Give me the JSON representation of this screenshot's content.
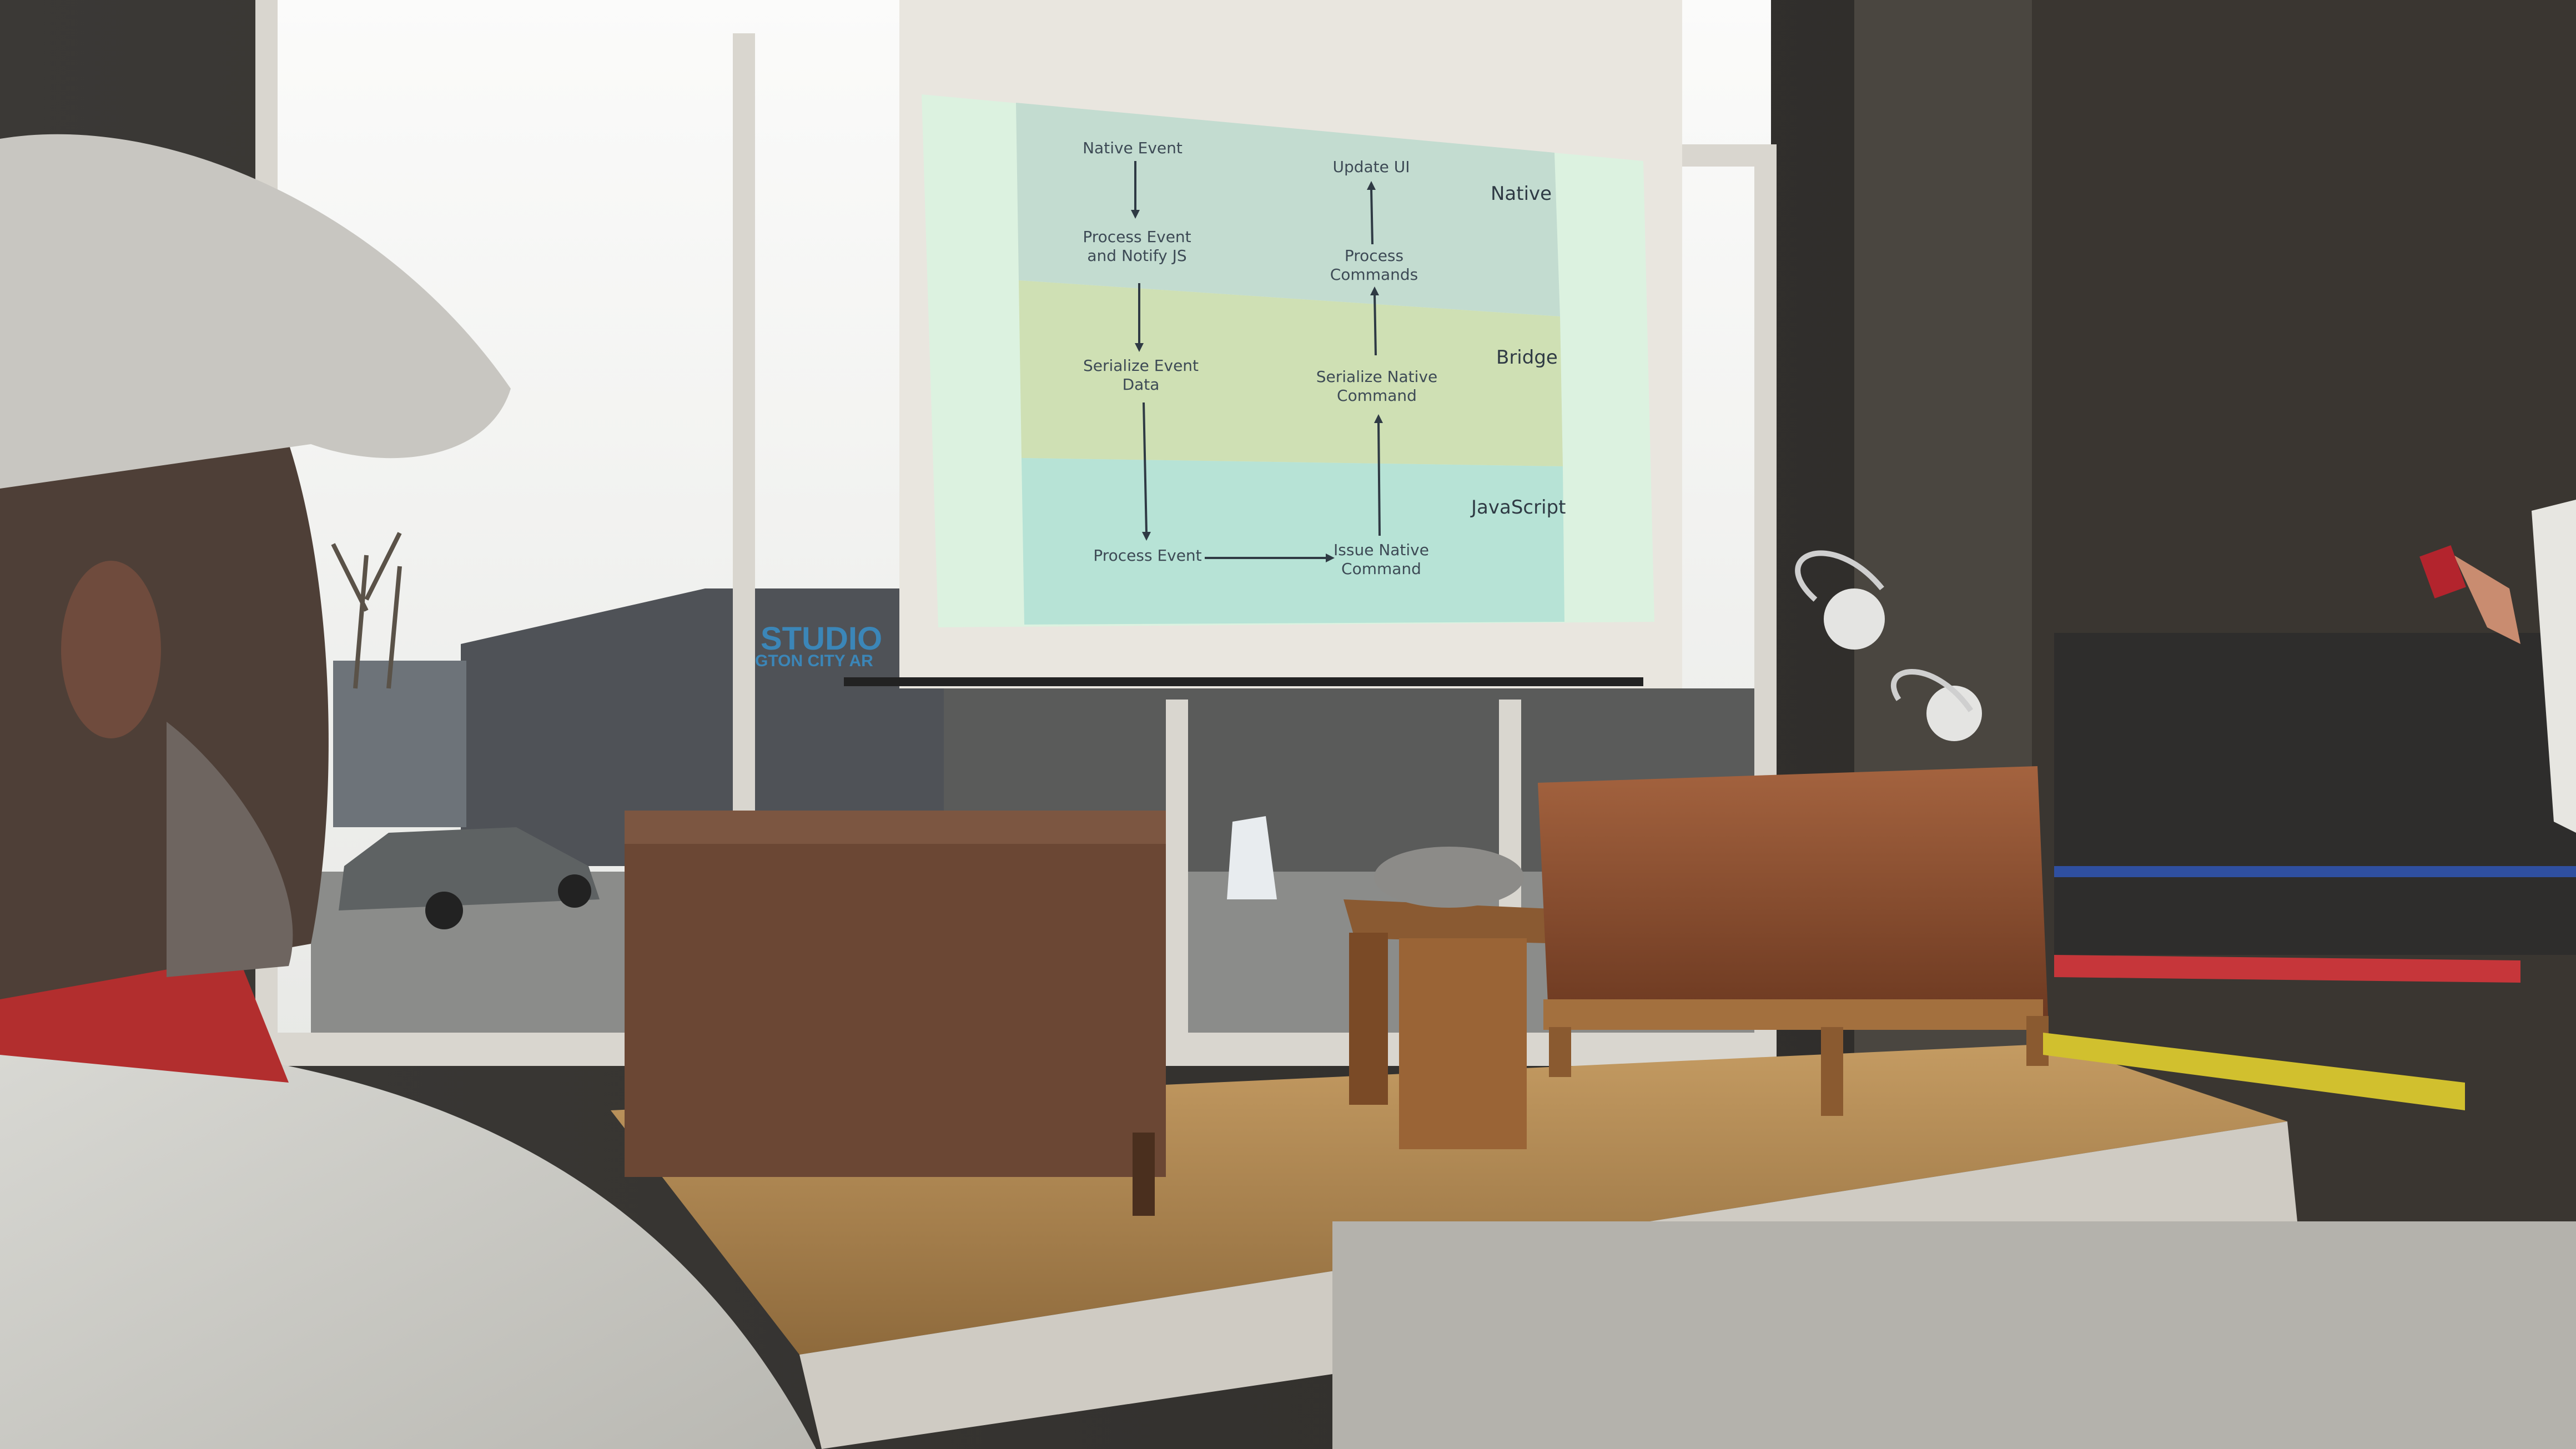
{
  "slide": {
    "steps": {
      "native_event": "Native Event",
      "process_event_notify_1": "Process Event",
      "process_event_notify_2": "and Notify JS",
      "serialize_event_1": "Serialize Event",
      "serialize_event_2": "Data",
      "process_event": "Process Event",
      "issue_native_1": "Issue Native",
      "issue_native_2": "Command",
      "serialize_native_1": "Serialize Native",
      "serialize_native_2": "Command",
      "process_commands_1": "Process",
      "process_commands_2": "Commands",
      "update_ui": "Update UI"
    },
    "bands": {
      "native": "Native",
      "bridge": "Bridge",
      "javascript": "JavaScript"
    }
  },
  "building_sign": {
    "line1": "STUDIO",
    "line2": "INGTON CITY AR"
  },
  "colors": {
    "native_band": "#c3dcd0",
    "bridge_band": "#cfe0b4",
    "javascript_band": "#b7e3d6",
    "slide_bg": "#dcf2e0",
    "screen_frame": "#e9e6df",
    "sky": "#f4f4f2",
    "floor": "#b98e55",
    "chair_leather": "#8b4b2b"
  }
}
